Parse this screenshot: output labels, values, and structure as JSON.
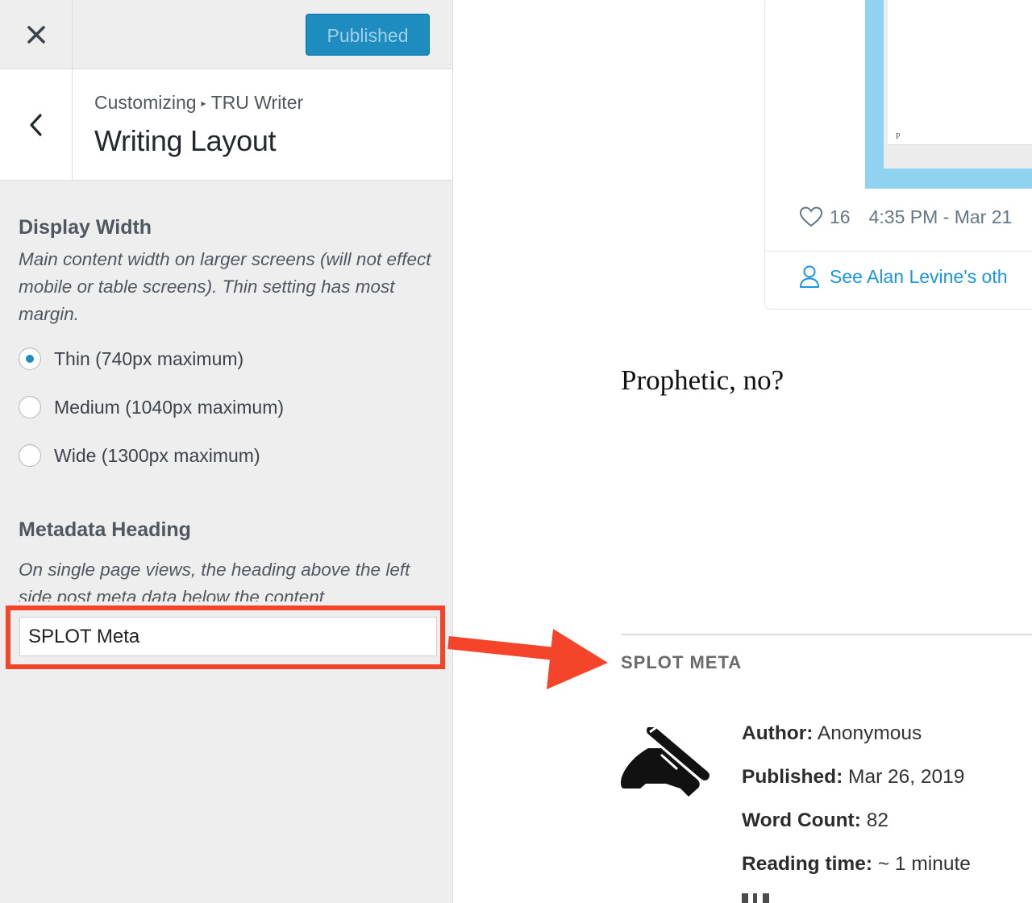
{
  "customizer": {
    "publish_button": "Published",
    "breadcrumb": {
      "root": "Customizing",
      "separator": "▸",
      "theme": "TRU Writer"
    },
    "section_title": "Writing Layout",
    "display_width": {
      "title": "Display Width",
      "description": "Main content width on larger screens (will not effect mobile or table screens). Thin setting has most margin.",
      "options": [
        {
          "label": "Thin (740px maximum)",
          "checked": true
        },
        {
          "label": "Medium (1040px maximum)",
          "checked": false
        },
        {
          "label": "Wide (1300px maximum)",
          "checked": false
        }
      ]
    },
    "metadata_heading": {
      "title": "Metadata Heading",
      "description": "On single page views, the heading above the left side post meta data below the content",
      "value": "SPLOT Meta"
    },
    "accent_color": "#1e8cbe",
    "highlight_color": "#f4452a"
  },
  "preview": {
    "tweet": {
      "image_letter": "P",
      "likes": "16",
      "timestamp": "4:35 PM - Mar 21",
      "profile_link": "See Alan Levine's oth"
    },
    "post_text": "Prophetic, no?",
    "meta_heading": "SPLOT META",
    "meta": {
      "author_label": "Author:",
      "author_value": "Anonymous",
      "published_label": "Published:",
      "published_value": "Mar 26, 2019",
      "wordcount_label": "Word Count:",
      "wordcount_value": "82",
      "readtime_label": "Reading time:",
      "readtime_value": "~ 1 minute"
    }
  },
  "icons": [
    "close-icon",
    "back-chevron-icon",
    "heart-icon",
    "user-icon",
    "writing-hand-icon",
    "arrow-annotation"
  ]
}
